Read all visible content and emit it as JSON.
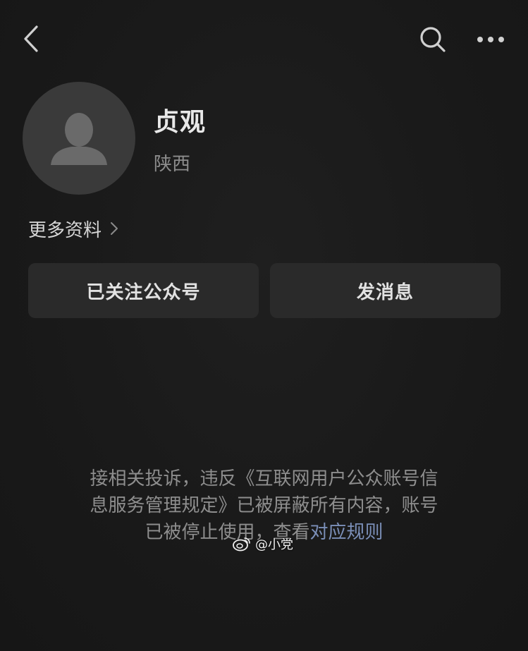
{
  "profile": {
    "name": "贞观",
    "region": "陕西",
    "more_info_label": "更多资料"
  },
  "actions": {
    "follow_label": "已关注公众号",
    "message_label": "发消息"
  },
  "notice": {
    "line1": "接相关投诉，违反《互联网用户公众账号信",
    "line2": "息服务管理规定》已被屏蔽所有内容，账号",
    "line3_prefix": "已被停止使用，查看",
    "line3_link": "对应规则"
  },
  "watermark": {
    "text": "@小党"
  },
  "colors": {
    "background": "#1b1b1b",
    "button_bg": "#2a2a2a",
    "link": "#7b8fb8",
    "avatar_bg": "#3a3a3a"
  },
  "icons": {
    "back": "chevron-left-icon",
    "search": "search-icon",
    "more": "more-horizontal-icon",
    "avatar": "default-avatar-icon",
    "more_info": "chevron-right-icon",
    "watermark": "weibo-logo-icon"
  }
}
